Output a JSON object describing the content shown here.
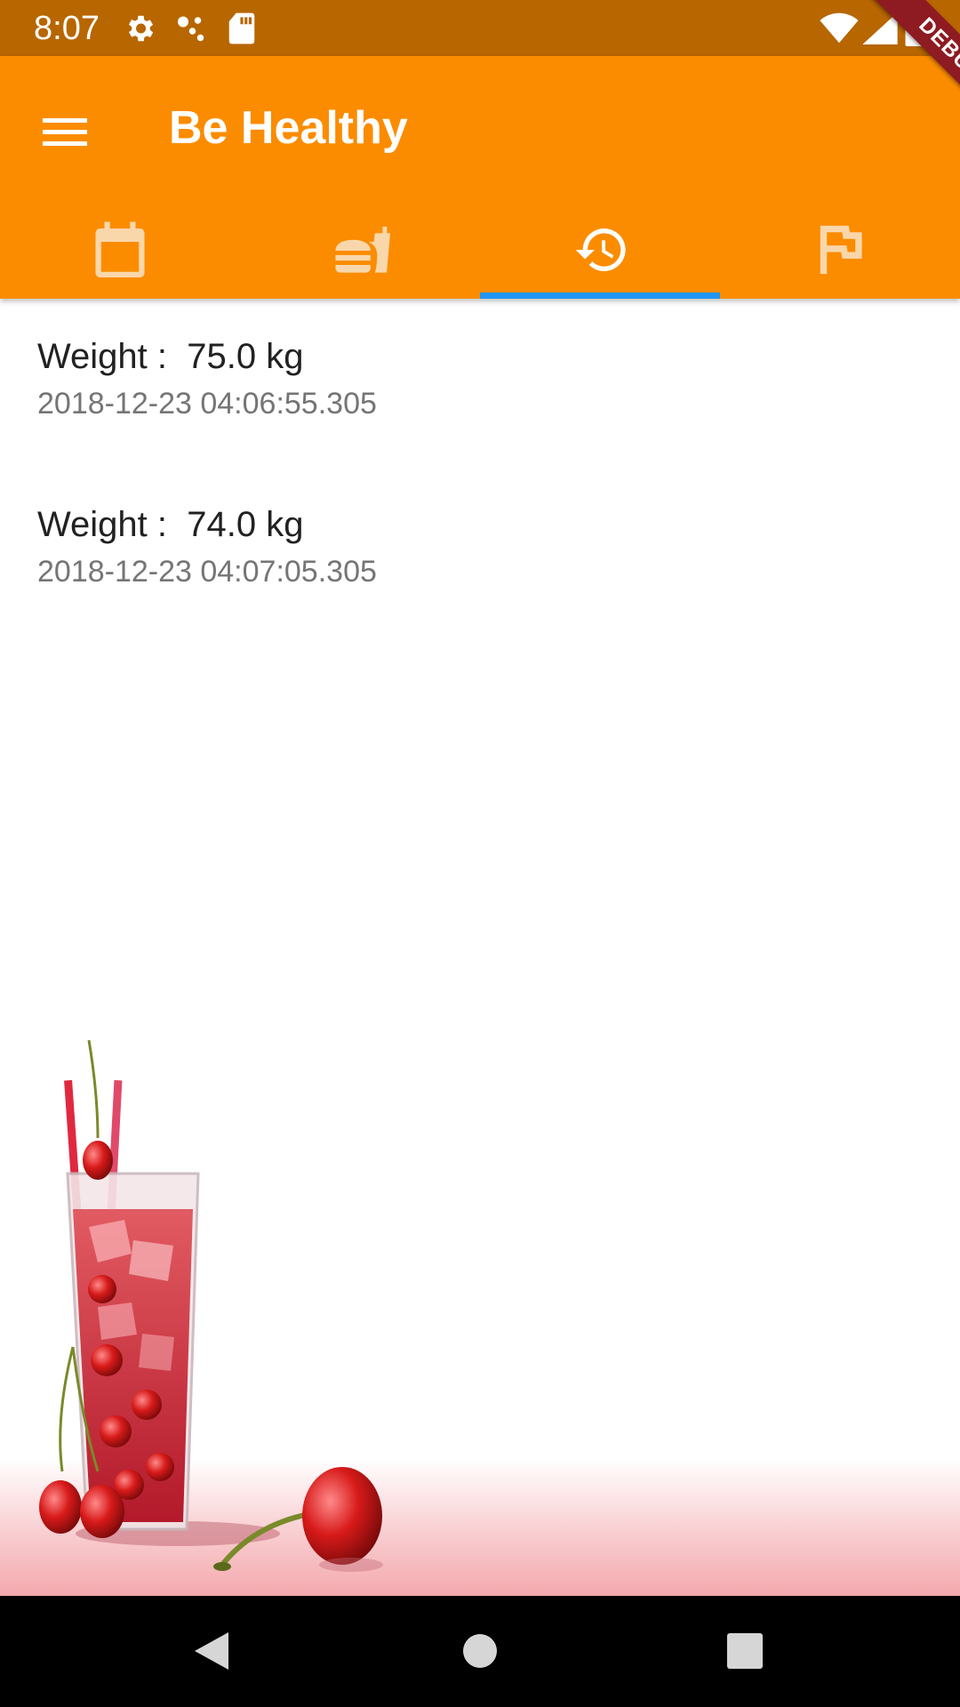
{
  "status_bar": {
    "time": "8:07",
    "icons": [
      "settings-icon",
      "cast-dots-icon",
      "sd-card-icon",
      "wifi-icon",
      "signal-icon",
      "battery-icon"
    ]
  },
  "debug_banner": {
    "label": "DEBUG"
  },
  "app_bar": {
    "title": "Be Healthy",
    "menu_icon": "menu-icon",
    "background_color": "#fb8c00",
    "status_color": "#b76600"
  },
  "tabs": [
    {
      "icon": "calendar-icon",
      "selected": false
    },
    {
      "icon": "fastfood-icon",
      "selected": false
    },
    {
      "icon": "history-icon",
      "selected": true
    },
    {
      "icon": "flag-icon",
      "selected": false
    }
  ],
  "tab_indicator_color": "#2196f3",
  "history": [
    {
      "weight": "Weight :  75.0 kg",
      "date": "2018-12-23 04:06:55.305"
    },
    {
      "weight": "Weight :  74.0 kg",
      "date": "2018-12-23 04:07:05.305"
    }
  ],
  "decoration": {
    "image": "cherry-juice-glass-illustration"
  },
  "nav_bar": {
    "icons": [
      "back-icon",
      "home-icon",
      "recents-icon"
    ]
  }
}
